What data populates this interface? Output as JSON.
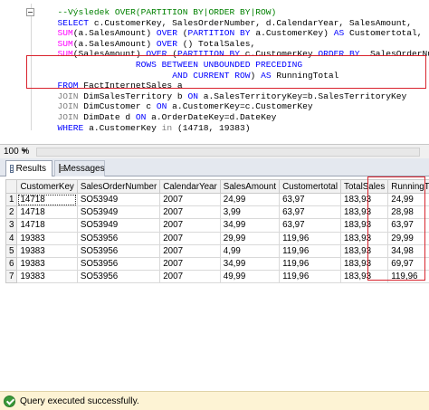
{
  "editor": {
    "lines": [
      {
        "indent": "  ",
        "parts": [
          {
            "t": "--Výsledek OVER(PARTITION BY|ORDER BY|ROW)",
            "c": "cm"
          }
        ]
      },
      {
        "indent": "  ",
        "parts": [
          {
            "t": "SELECT",
            "c": "kw"
          },
          {
            "t": " c.CustomerKey, SalesOrderNumber, d.CalendarYear, SalesAmount,",
            "c": ""
          }
        ]
      },
      {
        "indent": "  ",
        "parts": [
          {
            "t": "SUM",
            "c": "fn"
          },
          {
            "t": "(a.SalesAmount) ",
            "c": ""
          },
          {
            "t": "OVER",
            "c": "kw"
          },
          {
            "t": " (",
            "c": ""
          },
          {
            "t": "PARTITION BY",
            "c": "kw"
          },
          {
            "t": " a.CustomerKey) ",
            "c": ""
          },
          {
            "t": "AS",
            "c": "kw"
          },
          {
            "t": " Customertotal,",
            "c": ""
          }
        ]
      },
      {
        "indent": "  ",
        "parts": [
          {
            "t": "SUM",
            "c": "fn"
          },
          {
            "t": "(a.SalesAmount) ",
            "c": ""
          },
          {
            "t": "OVER",
            "c": "kw"
          },
          {
            "t": " () TotalSales,",
            "c": ""
          }
        ]
      },
      {
        "indent": "  ",
        "parts": [
          {
            "t": "SUM",
            "c": "fn"
          },
          {
            "t": "(SalesAmount) ",
            "c": ""
          },
          {
            "t": "OVER",
            "c": "kw"
          },
          {
            "t": " (",
            "c": ""
          },
          {
            "t": "PARTITION BY",
            "c": "kw"
          },
          {
            "t": " c.CustomerKey ",
            "c": ""
          },
          {
            "t": "ORDER BY",
            "c": "kw"
          },
          {
            "t": "  SalesOrderNumber",
            "c": ""
          }
        ]
      },
      {
        "indent": "                 ",
        "parts": [
          {
            "t": "ROWS BETWEEN UNBOUNDED PRECEDING",
            "c": "kw"
          }
        ]
      },
      {
        "indent": "                        ",
        "parts": [
          {
            "t": "AND CURRENT ROW",
            "c": "kw"
          },
          {
            "t": ") ",
            "c": ""
          },
          {
            "t": "AS",
            "c": "kw"
          },
          {
            "t": " RunningTotal",
            "c": ""
          }
        ]
      },
      {
        "indent": "  ",
        "parts": [
          {
            "t": "FROM",
            "c": "kw"
          },
          {
            "t": " FactInternetSales a",
            "c": ""
          }
        ]
      },
      {
        "indent": "  ",
        "parts": [
          {
            "t": "JOIN",
            "c": "op"
          },
          {
            "t": " DimSalesTerritory b ",
            "c": ""
          },
          {
            "t": "ON",
            "c": "kw"
          },
          {
            "t": " a.SalesTerritoryKey=b.SalesTerritoryKey",
            "c": ""
          }
        ]
      },
      {
        "indent": "  ",
        "parts": [
          {
            "t": "JOIN",
            "c": "op"
          },
          {
            "t": " DimCustomer c ",
            "c": ""
          },
          {
            "t": "ON",
            "c": "kw"
          },
          {
            "t": " a.CustomerKey=c.CustomerKey",
            "c": ""
          }
        ]
      },
      {
        "indent": "  ",
        "parts": [
          {
            "t": "JOIN",
            "c": "op"
          },
          {
            "t": " DimDate d ",
            "c": ""
          },
          {
            "t": "ON",
            "c": "kw"
          },
          {
            "t": " a.OrderDateKey=d.DateKey",
            "c": ""
          }
        ]
      },
      {
        "indent": "  ",
        "parts": [
          {
            "t": "WHERE",
            "c": "kw"
          },
          {
            "t": " a.CustomerKey ",
            "c": ""
          },
          {
            "t": "in",
            "c": "op"
          },
          {
            "t": " (14718, 19383)",
            "c": ""
          }
        ]
      }
    ]
  },
  "zoom": "100 %",
  "tabs": {
    "results": "Results",
    "messages": "Messages"
  },
  "grid": {
    "columns": [
      "",
      "CustomerKey",
      "SalesOrderNumber",
      "CalendarYear",
      "SalesAmount",
      "Customertotal",
      "TotalSales",
      "RunningTotal"
    ],
    "rows": [
      [
        "1",
        "14718",
        "SO53949",
        "2007",
        "24,99",
        "63,97",
        "183,93",
        "24,99"
      ],
      [
        "2",
        "14718",
        "SO53949",
        "2007",
        "3,99",
        "63,97",
        "183,93",
        "28,98"
      ],
      [
        "3",
        "14718",
        "SO53949",
        "2007",
        "34,99",
        "63,97",
        "183,93",
        "63,97"
      ],
      [
        "4",
        "19383",
        "SO53956",
        "2007",
        "29,99",
        "119,96",
        "183,93",
        "29,99"
      ],
      [
        "5",
        "19383",
        "SO53956",
        "2007",
        "4,99",
        "119,96",
        "183,93",
        "34,98"
      ],
      [
        "6",
        "19383",
        "SO53956",
        "2007",
        "34,99",
        "119,96",
        "183,93",
        "69,97"
      ],
      [
        "7",
        "19383",
        "SO53956",
        "2007",
        "49,99",
        "119,96",
        "183,93",
        "119,96"
      ]
    ]
  },
  "status": {
    "message": "Query executed successfully."
  },
  "colors": {
    "highlight_border": "#d9232d",
    "keyword": "#0000ff",
    "function": "#ff00ff",
    "comment": "#008000",
    "status_bg": "#fdf3d4"
  }
}
